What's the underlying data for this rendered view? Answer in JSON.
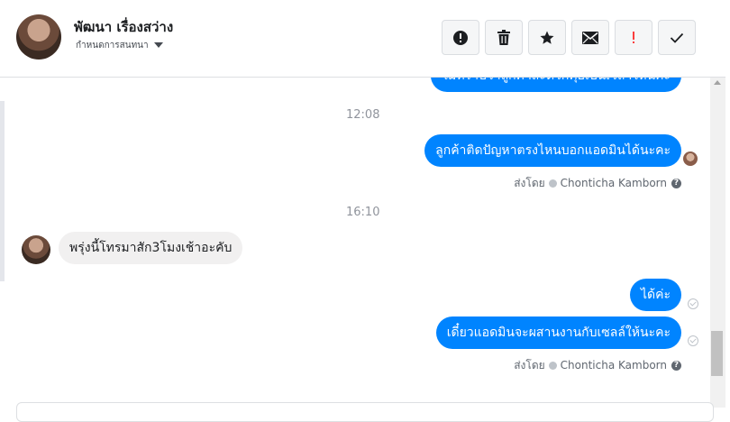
{
  "header": {
    "contact_name": "พัฒนา เรื่องสว่าง",
    "subtitle": "กำหนดการสนทนา",
    "toolbar": {
      "spam_label": "Mark as spam",
      "delete_label": "Delete",
      "star_label": "Star",
      "unread_label": "Mark as unread",
      "follow_up_label": "Follow up",
      "done_label": "Done"
    }
  },
  "messages": {
    "partial_top": "ไม่ทราบว่าลูกค้าสะดวกคุยเป็นเวลาไหนค่ะ",
    "time_1": "12:08",
    "out_1": "ลูกค้าติดปัญหาตรงไหนบอกแอดมินได้นะคะ",
    "sent_by_label_1": "ส่งโดย",
    "sent_by_name_1": "Chonticha Kamborn",
    "time_2": "16:10",
    "in_1": "พรุ่งนี้โทรมาสัก3โมงเช้าอะคับ",
    "out_2": "ได้ค่ะ",
    "out_3": "เดี๋ยวแอดมินจะผสานงานกับเซลล์ให้นะคะ",
    "sent_by_label_2": "ส่งโดย",
    "sent_by_name_2": "Chonticha Kamborn"
  },
  "colors": {
    "outgoing_bubble": "#0084ff",
    "incoming_bubble": "#f1f0f0",
    "follow_up_red": "#fa3e3e"
  }
}
